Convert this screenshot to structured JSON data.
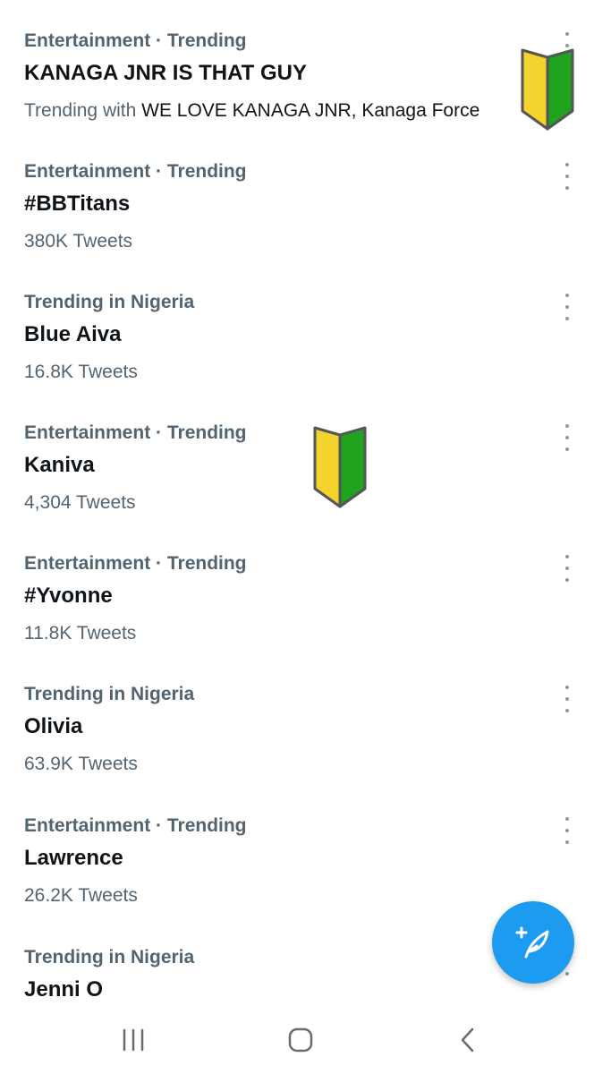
{
  "trends": [
    {
      "context": "Entertainment · Trending",
      "title": "KANAGA JNR IS THAT GUY",
      "meta_prefix": "Trending with ",
      "meta_highlight": "WE LOVE KANAGA JNR, Kanaga Force"
    },
    {
      "context": "Entertainment · Trending",
      "title": "#BBTitans",
      "meta": "380K Tweets"
    },
    {
      "context": "Trending in Nigeria",
      "title": "Blue Aiva",
      "meta": "16.8K Tweets"
    },
    {
      "context": "Entertainment · Trending",
      "title": "Kaniva",
      "meta": "4,304 Tweets"
    },
    {
      "context": "Entertainment · Trending",
      "title": "#Yvonne",
      "meta": "11.8K Tweets"
    },
    {
      "context": "Trending in Nigeria",
      "title": "Olivia",
      "meta": "63.9K Tweets"
    },
    {
      "context": "Entertainment · Trending",
      "title": "Lawrence",
      "meta": "26.2K Tweets"
    },
    {
      "context": "Trending in Nigeria",
      "title": "Jenni O"
    }
  ],
  "icons": {
    "more": "more-vertical-icon",
    "badge": "japanese-beginner-symbol-icon",
    "compose": "compose-tweet-icon",
    "recents": "recent-apps-icon",
    "home": "home-icon",
    "back": "back-icon"
  },
  "colors": {
    "accent": "#1d9bf0",
    "secondary_text": "#536471",
    "primary_text": "#0f1419",
    "badge_yellow": "#f5d32e",
    "badge_green": "#1fa31f"
  }
}
